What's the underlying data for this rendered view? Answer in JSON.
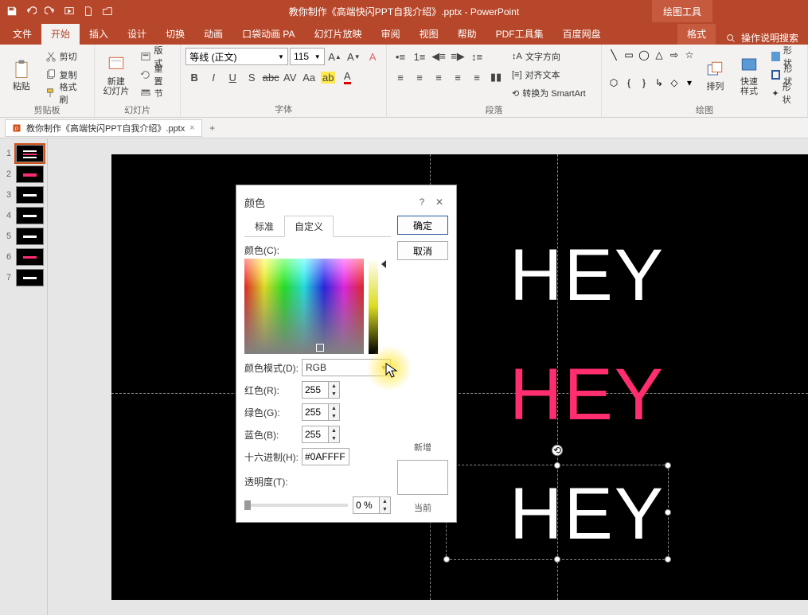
{
  "app": {
    "doc_title": "教你制作《高端快闪PPT自我介绍》.pptx - PowerPoint",
    "drawing_tools": "绘图工具"
  },
  "tabs": {
    "file": "文件",
    "home": "开始",
    "insert": "插入",
    "design": "设计",
    "transitions": "切换",
    "animations": "动画",
    "islide": "口袋动画 PA",
    "slideshow": "幻灯片放映",
    "review": "审阅",
    "view": "视图",
    "help": "帮助",
    "pdf": "PDF工具集",
    "baidu": "百度网盘",
    "format": "格式",
    "tell_me": "操作说明搜索"
  },
  "ribbon": {
    "clipboard": {
      "paste": "粘贴",
      "cut": "剪切",
      "copy": "复制",
      "painter": "格式刷",
      "label": "剪贴板"
    },
    "slides": {
      "new_slide": "新建\n幻灯片",
      "layout": "版式",
      "reset": "重置",
      "section": "节",
      "label": "幻灯片"
    },
    "font": {
      "name": "等线 (正文)",
      "size": "115",
      "label": "字体"
    },
    "paragraph": {
      "text_dir": "文字方向",
      "align_text": "对齐文本",
      "smartart": "转换为 SmartArt",
      "label": "段落"
    },
    "drawing": {
      "arrange": "排列",
      "quick_style": "快速样式",
      "shape_fill": "形状",
      "shape_outline": "形状",
      "shape_effects": "形状",
      "label": "绘图"
    }
  },
  "doc_tab": {
    "name": "教你制作《高端快闪PPT自我介绍》.pptx"
  },
  "thumbs": [
    1,
    2,
    3,
    4,
    5,
    6,
    7
  ],
  "slide": {
    "hey1": "HEY",
    "hey2": "HEY",
    "hey3": "HEY"
  },
  "dlg": {
    "title": "颜色",
    "tab_standard": "标准",
    "tab_custom": "自定义",
    "ok": "确定",
    "cancel": "取消",
    "colors_label": "颜色(C):",
    "mode_label": "颜色模式(D):",
    "mode_value": "RGB",
    "red_label": "红色(R):",
    "red_value": "255",
    "green_label": "绿色(G):",
    "green_value": "255",
    "blue_label": "蓝色(B):",
    "blue_value": "255",
    "hex_label": "十六进制(H):",
    "hex_value": "#0AFFFF",
    "trans_label": "透明度(T):",
    "percent": "0 %",
    "new_label": "新增",
    "current_label": "当前"
  }
}
